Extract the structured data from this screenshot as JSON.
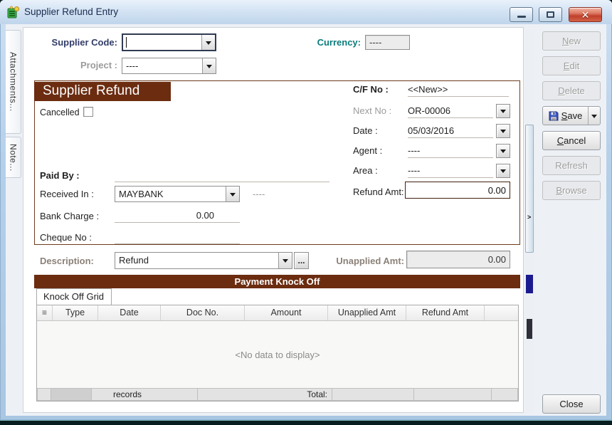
{
  "window": {
    "title": "Supplier Refund Entry"
  },
  "window_controls": {
    "minimize_icon": "minimize",
    "maximize_icon": "maximize",
    "close_icon": "✕"
  },
  "side_tabs": [
    {
      "label": "Attachments..."
    },
    {
      "label": "Note..."
    }
  ],
  "header_fields": {
    "supplier_code": {
      "label": "Supplier Code:",
      "value": ""
    },
    "currency": {
      "label": "Currency:",
      "value": "----"
    },
    "project": {
      "label": "Project :",
      "value": "----"
    }
  },
  "refund_section": {
    "title": "Supplier Refund",
    "cancelled_label": "Cancelled",
    "cf_no": {
      "label": "C/F No :",
      "value": "<<New>>"
    },
    "next_no": {
      "label": "Next No :",
      "value": "OR-00006"
    },
    "date": {
      "label": "Date :",
      "value": "05/03/2016"
    },
    "agent": {
      "label": "Agent :",
      "value": "----"
    },
    "area": {
      "label": "Area :",
      "value": "----"
    },
    "refund_amt": {
      "label": "Refund Amt:",
      "value": "0.00"
    },
    "paid_by": {
      "label": "Paid By :",
      "value": ""
    },
    "received_in": {
      "label": "Received In :",
      "value": "MAYBANK",
      "suffix": "----"
    },
    "bank_charge": {
      "label": "Bank Charge :",
      "value": "0.00"
    },
    "cheque_no": {
      "label": "Cheque No :",
      "value": ""
    }
  },
  "description_row": {
    "description": {
      "label": "Description:",
      "value": "Refund"
    },
    "ellipsis_button": "...",
    "unapplied_amt": {
      "label": "Unapplied Amt:",
      "value": "0.00"
    }
  },
  "knockoff": {
    "banner": "Payment Knock Off",
    "tab": "Knock Off Grid",
    "menu_icon": "≡",
    "columns": [
      "Type",
      "Date",
      "Doc No.",
      "Amount",
      "Unapplied Amt",
      "Refund Amt"
    ],
    "empty_text": "<No data to display>",
    "footer": {
      "records_label": "records",
      "total_label": "Total:"
    }
  },
  "action_buttons": [
    {
      "name": "new-button",
      "label": "New",
      "enabled": false,
      "underline": true
    },
    {
      "name": "edit-button",
      "label": "Edit",
      "enabled": false,
      "underline": true
    },
    {
      "name": "delete-button",
      "label": "Delete",
      "enabled": false,
      "underline": true
    },
    {
      "name": "save-button",
      "label": "Save",
      "enabled": true,
      "underline": true,
      "icon": "floppy-disk-icon",
      "split": true
    },
    {
      "name": "cancel-button",
      "label": "Cancel",
      "enabled": true,
      "underline": true
    },
    {
      "name": "refresh-button",
      "label": "Refresh",
      "enabled": false,
      "underline": false
    },
    {
      "name": "browse-button",
      "label": "Browse",
      "enabled": false,
      "underline": true
    }
  ],
  "close_button": {
    "label": "Close"
  },
  "colors": {
    "band_maroon": "#6b2c10",
    "teal_label": "#0c7b7b",
    "navy_label": "#323c68",
    "close_red": "#c0402c"
  }
}
